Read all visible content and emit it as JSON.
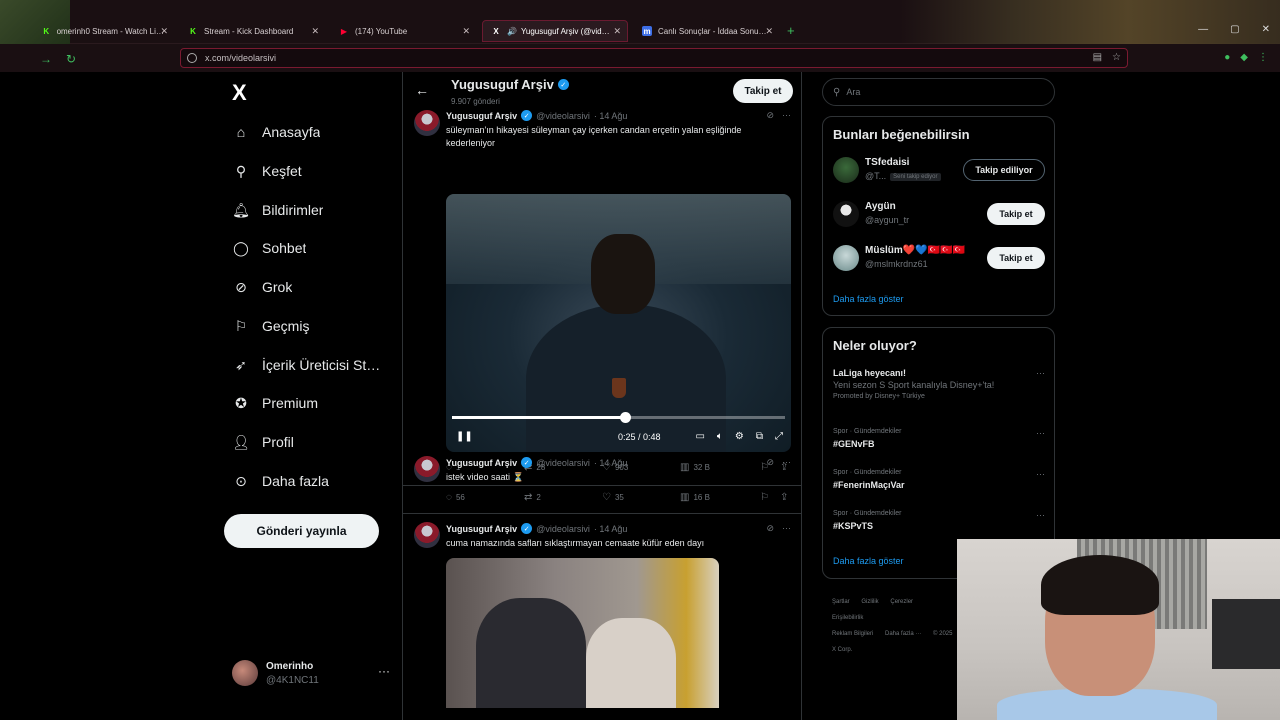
{
  "browser": {
    "tabs": [
      {
        "title": "omerinh0 Stream - Watch Live on ...",
        "favicon": "K",
        "color": "#53fc18"
      },
      {
        "title": "Stream - Kick Dashboard",
        "favicon": "K",
        "color": "#53fc18"
      },
      {
        "title": "(174) YouTube",
        "favicon": "▶",
        "color": "#ff0033"
      },
      {
        "title": "Yugusuguf Arşiv (@videolarsivi)",
        "favicon": "X",
        "color": "#ffffff"
      },
      {
        "title": "Canlı Sonuçlar - İddaa Sonuçları",
        "favicon": "m",
        "color": "#3d6ee6"
      }
    ],
    "new_tab": "+",
    "url": "x.com/videolarsivi"
  },
  "nav": {
    "logo": "X",
    "items": [
      {
        "label": "Anasayfa",
        "icon": "home-icon"
      },
      {
        "label": "Keşfet",
        "icon": "search-icon"
      },
      {
        "label": "Bildirimler",
        "icon": "bell-icon"
      },
      {
        "label": "Sohbet",
        "icon": "chat-icon"
      },
      {
        "label": "Grok",
        "icon": "grok-icon"
      },
      {
        "label": "Geçmiş",
        "icon": "bookmark-icon"
      },
      {
        "label": "İçerik Üreticisi Stü...",
        "icon": "rocket-icon"
      },
      {
        "label": "Premium",
        "icon": "premium-icon"
      },
      {
        "label": "Profil",
        "icon": "profile-icon"
      },
      {
        "label": "Daha fazla",
        "icon": "more-icon"
      }
    ],
    "post_button": "Gönderi yayınla",
    "account": {
      "name": "Omerinho",
      "handle": "@4K1NC11"
    }
  },
  "profile_header": {
    "name": "Yugusuguf Arşiv",
    "post_count": "9.907 gönderi",
    "follow": "Takip et"
  },
  "tweets": [
    {
      "name": "Yugusuguf Arşiv",
      "handle": "@videolarsivi",
      "date": "· 14 Ağu",
      "text": "süleyman'ın hikayesi süleyman çay içerken candan erçetin yalan eşliğinde kederleniyor",
      "video": {
        "time": "0:25 / 0:48",
        "progress": 0.52
      },
      "replies": "1",
      "reposts": "28",
      "likes": "903",
      "views": "32 B"
    },
    {
      "name": "Yugusuguf Arşiv",
      "handle": "@videolarsivi",
      "date": "· 14 Ağu",
      "text": "istek video saati ⏳",
      "replies": "56",
      "reposts": "2",
      "likes": "35",
      "views": "16 B"
    },
    {
      "name": "Yugusuguf Arşiv",
      "handle": "@videolarsivi",
      "date": "· 14 Ağu",
      "text": "cuma namazında safları sıklaştırmayan cemaate küfür eden dayı"
    }
  ],
  "sidebar": {
    "search_placeholder": "Ara",
    "who_to_follow": {
      "title": "Bunları beğenebilirsin",
      "accounts": [
        {
          "name": "TSfedaisi",
          "handle": "@T...",
          "badge": "Seni takip ediyor",
          "button": "Takip ediliyor"
        },
        {
          "name": "Aygün",
          "handle": "@aygun_tr",
          "badge": "",
          "button": "Takip et"
        },
        {
          "name": "Müslüm❤️💙🇹🇷🇹🇷🇹🇷",
          "handle": "@mslmkrdnz61",
          "badge": "",
          "button": "Takip et"
        }
      ],
      "show_more": "Daha fazla göster"
    },
    "trends": {
      "title": "Neler oluyor?",
      "items": [
        {
          "meta": "",
          "title": "LaLiga heyecanı!",
          "sub": "Yeni sezon S Sport kanalıyla Disney+'ta!",
          "promo": "Promoted by Disney+ Türkiye"
        },
        {
          "meta": "Spor · Gündemdekiler",
          "title": "#GENvFB",
          "sub": "",
          "promo": ""
        },
        {
          "meta": "Spor · Gündemdekiler",
          "title": "#FenerinMaçıVar",
          "sub": "",
          "promo": ""
        },
        {
          "meta": "Spor · Gündemdekiler",
          "title": "#KSPvTS",
          "sub": "",
          "promo": ""
        }
      ],
      "show_more": "Daha fazla göster"
    },
    "footer": [
      "Şartlar",
      "Gizlilik",
      "Çerezler",
      "Erişilebilirlik",
      "Reklam Bilgileri",
      "Daha fazla ···",
      "© 2025 X Corp."
    ]
  },
  "colors": {
    "accent": "#1d9bf0",
    "border": "#2f3336",
    "muted": "#71767b"
  }
}
